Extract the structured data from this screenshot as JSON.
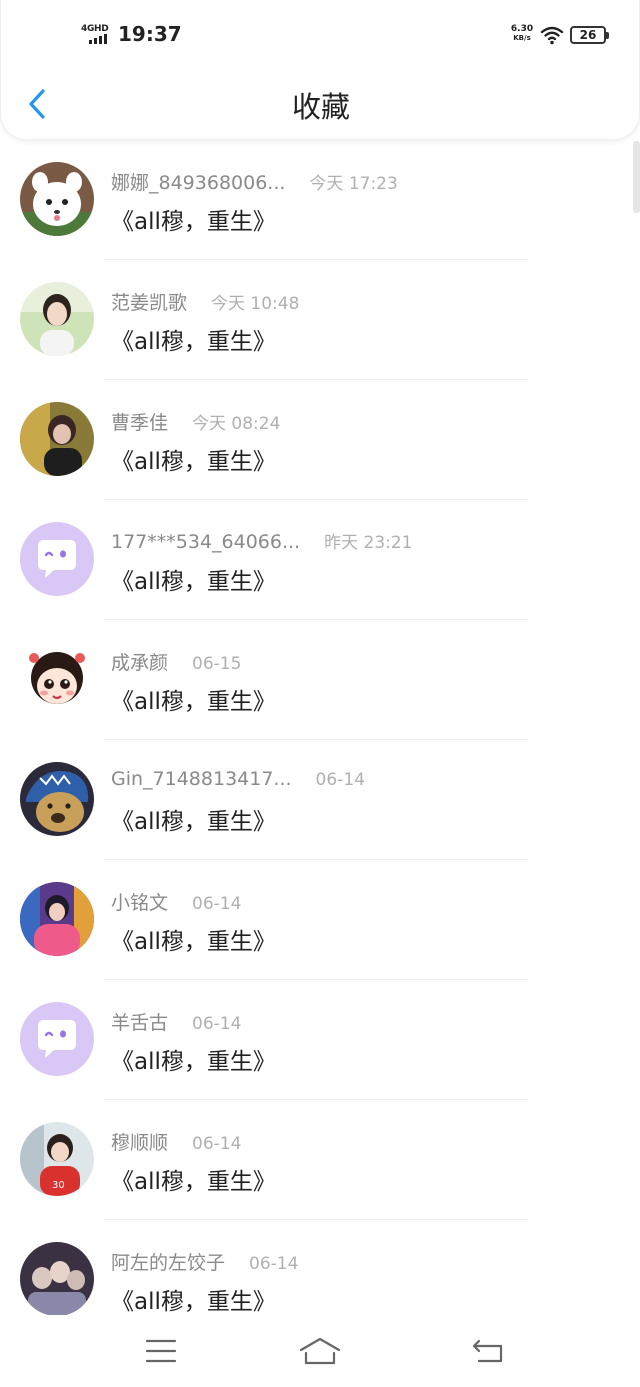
{
  "status_bar": {
    "network": "4GHD",
    "time": "19:37",
    "speed_value": "6.30",
    "speed_unit": "KB/s",
    "battery": "26"
  },
  "header": {
    "title": "收藏"
  },
  "favorites": [
    {
      "name": "娜娜_849368006...",
      "time": "今天 17:23",
      "title": "《all穆，重生》",
      "avatar": "white-puppy"
    },
    {
      "name": "范姜凯歌",
      "time": "今天 10:48",
      "title": "《all穆，重生》",
      "avatar": "girl-portrait"
    },
    {
      "name": "曹季佳",
      "time": "今天 08:24",
      "title": "《all穆，重生》",
      "avatar": "dark-portrait"
    },
    {
      "name": "177***534_64066...",
      "time": "昨天 23:21",
      "title": "《all穆，重生》",
      "avatar": "default-chat"
    },
    {
      "name": "成承颜",
      "time": "06-15",
      "title": "《all穆，重生》",
      "avatar": "cartoon-girl"
    },
    {
      "name": "Gin_7148813417...",
      "time": "06-14",
      "title": "《all穆，重生》",
      "avatar": "dog-shark-hat"
    },
    {
      "name": "小铭文",
      "time": "06-14",
      "title": "《all穆，重生》",
      "avatar": "colorful-portrait"
    },
    {
      "name": "羊舌古",
      "time": "06-14",
      "title": "《all穆，重生》",
      "avatar": "default-chat"
    },
    {
      "name": "穆顺顺",
      "time": "06-14",
      "title": "《all穆，重生》",
      "avatar": "boy-portrait"
    },
    {
      "name": "阿左的左饺子",
      "time": "06-14",
      "title": "《all穆，重生》",
      "avatar": "group-photo"
    }
  ],
  "colors": {
    "accent": "#2196f3",
    "default_avatar_bg": "#d9c8f5",
    "default_avatar_fg": "#9a74e0"
  },
  "nav_bar": {
    "icons": [
      "menu-icon",
      "home-icon",
      "back-icon"
    ]
  }
}
